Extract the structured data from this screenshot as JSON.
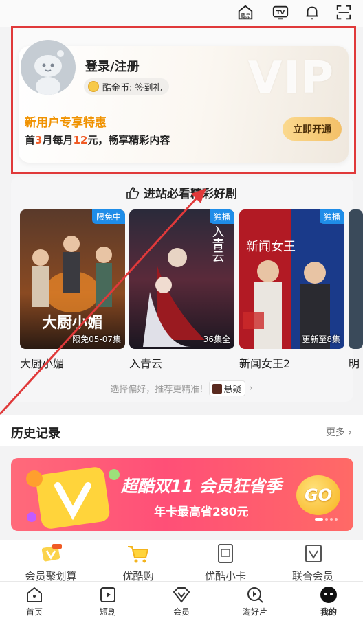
{
  "top_icons": [
    "collection-icon",
    "tv-icon",
    "bell-icon",
    "scan-icon"
  ],
  "top_icon_labels": {
    "collection": "藏品",
    "tv": "TV"
  },
  "vip": {
    "login_label": "登录/注册",
    "coin_label": "酷金币: 签到礼",
    "watermark": "VIP",
    "promo_title": "新用户专享特惠",
    "promo_desc_parts": [
      "首",
      "3",
      "月每月",
      "12",
      "元，畅享精彩内容"
    ],
    "open_button": "立即开通"
  },
  "recommend": {
    "header": "进站必看精彩好剧",
    "items": [
      {
        "title": "大厨小媚",
        "badge": "限免中",
        "episode": "限免05-07集",
        "poster_text": "大厨小媚"
      },
      {
        "title": "入青云",
        "badge": "独播",
        "episode": "36集全",
        "poster_text": "入青云"
      },
      {
        "title": "新闻女王2",
        "badge": "独播",
        "episode": "更新至8集",
        "poster_text": "新闻女王"
      },
      {
        "title": "明"
      }
    ],
    "preference_text": "选择偏好，推荐更精准!",
    "genre_chip": "悬疑"
  },
  "history": {
    "title": "历史记录",
    "more": "更多"
  },
  "banner": {
    "title": "超酷双11 会员狂省季",
    "subtitle": "年卡最高省280元",
    "go": "GO"
  },
  "quick_links": [
    {
      "label": "会员聚划算",
      "icon": "vip-deal-icon"
    },
    {
      "label": "优酷购",
      "icon": "cart-icon"
    },
    {
      "label": "优酷小卡",
      "icon": "card-icon"
    },
    {
      "label": "联合会员",
      "icon": "joint-vip-icon"
    }
  ],
  "tabs": [
    {
      "label": "首页",
      "icon": "home-icon"
    },
    {
      "label": "短剧",
      "icon": "short-drama-icon"
    },
    {
      "label": "会员",
      "icon": "vip-diamond-icon"
    },
    {
      "label": "淘好片",
      "icon": "search-movie-icon"
    },
    {
      "label": "我的",
      "icon": "profile-icon"
    }
  ],
  "colors": {
    "accent_orange": "#f09200",
    "price_red": "#f05a24",
    "badge_blue": "#1f8de8",
    "highlight_red": "#e0393a"
  }
}
